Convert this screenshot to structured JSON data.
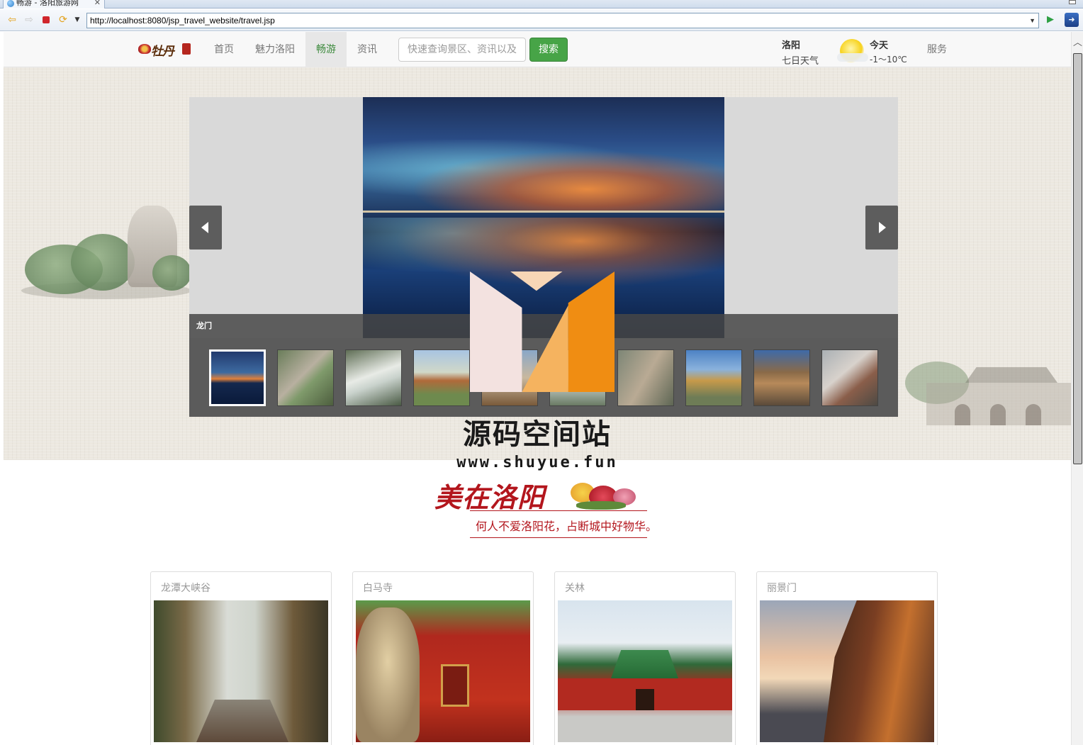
{
  "browser": {
    "tab_title": "畅游 - 洛阳旅游网",
    "tab_close": "✕",
    "url": "http://localhost:8080/jsp_travel_website/travel.jsp",
    "icons": [
      "back-icon",
      "forward-icon",
      "stop-icon",
      "refresh-icon",
      "dropdown-icon",
      "go-icon",
      "extension-icon"
    ]
  },
  "header": {
    "logo_text": "牡丹",
    "menu": [
      {
        "label": "首页"
      },
      {
        "label": "魅力洛阳"
      },
      {
        "label": "畅游",
        "active": true
      },
      {
        "label": "资讯"
      }
    ],
    "search": {
      "placeholder": "快速查询景区、资讯以及",
      "button": "搜索"
    },
    "weather": {
      "city": "洛阳",
      "link": "七日天气",
      "day": "今天",
      "temp": "-1～10℃",
      "icon": "sunny-cloud-icon"
    },
    "service": "服务"
  },
  "slider": {
    "caption": "龙门",
    "thumbnails": [
      "龙门",
      "thumb-2",
      "thumb-3",
      "thumb-4",
      "thumb-5",
      "thumb-6",
      "thumb-7",
      "thumb-8",
      "thumb-9",
      "thumb-10"
    ],
    "active_index": 0
  },
  "watermark": {
    "title": "源码空间站",
    "url": "www.shuyue.fun"
  },
  "section": {
    "title": "美在洛阳",
    "subtitle": "何人不爱洛阳花，占断城中好物华。"
  },
  "cards": [
    {
      "title": "龙潭大峡谷"
    },
    {
      "title": "白马寺"
    },
    {
      "title": "关林"
    },
    {
      "title": "丽景门"
    }
  ],
  "colors": {
    "active_menu_text": "#3c8a3c",
    "search_button": "#47a447",
    "section_red": "#b3161d",
    "slider_controls": "#5d5d5d"
  }
}
